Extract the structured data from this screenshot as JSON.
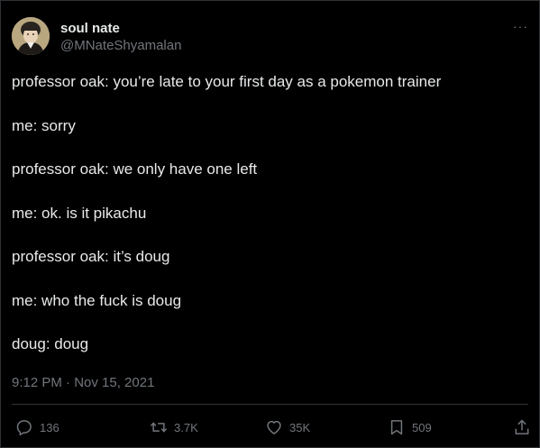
{
  "author": {
    "display_name": "soul nate",
    "handle": "@MNateShyamalan"
  },
  "tweet": {
    "lines": [
      "professor oak: you’re late to your first day as a pokemon trainer",
      "me: sorry",
      "professor oak: we only have one left",
      "me: ok. is it pikachu",
      "professor oak: it’s doug",
      "me: who the fuck is doug",
      "doug: doug"
    ],
    "timestamp": "9:12 PM · Nov 15, 2021"
  },
  "more_label": "···",
  "actions": {
    "reply": {
      "icon": "reply-icon",
      "count": "136"
    },
    "retweet": {
      "icon": "retweet-icon",
      "count": "3.7K"
    },
    "like": {
      "icon": "heart-icon",
      "count": "35K"
    },
    "bookmark": {
      "icon": "bookmark-icon",
      "count": "509"
    },
    "share": {
      "icon": "share-icon"
    }
  },
  "colors": {
    "background": "#000000",
    "text": "#e7e9ea",
    "secondary": "#71767b",
    "divider": "#2f3336"
  }
}
